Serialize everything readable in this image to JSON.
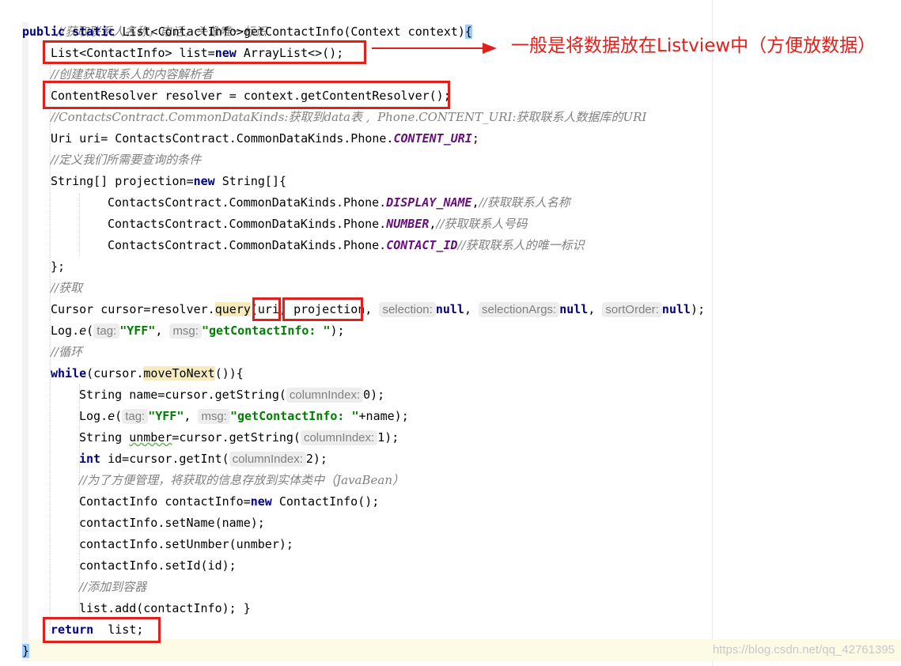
{
  "code": {
    "l1": "//获取联系人名称，电话，头像唯一标识",
    "l2a": "public static ",
    "l2b": "List<ContactInfo>getContactInfo(Context context)",
    "l2c": "{",
    "l3a": "List<ContactInfo> list=",
    "l3b": "new",
    "l3c": " ArrayList<>();",
    "l4": "//创建获取联系人的内容解析者",
    "l5": "ContentResolver resolver = context.getContentResolver();",
    "l6": "//ContactsContract.CommonDataKinds:获取到data表 ,  Phone.CONTENT_URI:获取联系人数据库的URI",
    "l7a": "Uri uri= ContactsContract.CommonDataKinds.Phone.",
    "l7b": "CONTENT_URI",
    "l7c": ";",
    "l8": "//定义我们所需要查询的条件",
    "l9a": "String[] projection=",
    "l9b": "new",
    "l9c": " String[]{",
    "l10a": "ContactsContract.CommonDataKinds.Phone.",
    "l10b": "DISPLAY_NAME",
    "l10c": ",",
    "l10d": "//获取联系人名称",
    "l11a": "ContactsContract.CommonDataKinds.Phone.",
    "l11b": "NUMBER",
    "l11c": ",",
    "l11d": "//获取联系人号码",
    "l12a": "ContactsContract.CommonDataKinds.Phone.",
    "l12b": "CONTACT_ID",
    "l12d": "//获取联系人的唯一标识",
    "l13": "};",
    "l14": "//获取",
    "l15a": "Cursor cursor=resolver.",
    "l15b": "query",
    "l15c": "(",
    "l15d": "uri",
    "l15e": ", ",
    "l15f": "projection",
    "l15g": ", ",
    "h15a": "selection:",
    "l15h": "null",
    "l15i": ", ",
    "h15b": "selectionArgs:",
    "l15j": "null",
    "l15k": ", ",
    "h15c": "sortOrder:",
    "l15l": "null",
    "l15m": ");",
    "l16a": "Log.",
    "l16b": "e",
    "l16c": "(",
    "h16a": "tag:",
    "l16d": "\"YFF\"",
    "l16e": ", ",
    "h16b": "msg:",
    "l16f": "\"getContactInfo: \"",
    "l16g": ");",
    "l17": "//循环",
    "l18a": "while",
    "l18b": "(cursor.",
    "l18c": "moveToNext",
    "l18d": "()){",
    "l19a": "String name=cursor.getString(",
    "h19": "columnIndex:",
    "l19b": "0",
    "l19c": ");",
    "l20a": "Log.",
    "l20b": "e",
    "l20c": "(",
    "h20a": "tag:",
    "l20d": "\"YFF\"",
    "l20e": ", ",
    "h20b": "msg:",
    "l20f": "\"getContactInfo: \"",
    "l20g": "+name);",
    "l21a": "String ",
    "l21b": "unmber",
    "l21c": "=cursor.getString(",
    "h21": "columnIndex:",
    "l21d": "1",
    "l21e": ");",
    "l22a": "int",
    "l22b": " id=cursor.getInt(",
    "h22": "columnIndex:",
    "l22c": "2",
    "l22d": ");",
    "l23": "//为了方便管理，将获取的信息存放到实体类中（JavaBean）",
    "l24a": "ContactInfo contactInfo=",
    "l24b": "new",
    "l24c": " ContactInfo();",
    "l25": "contactInfo.setName(name);",
    "l26": "contactInfo.setUnmber(unmber);",
    "l27": "contactInfo.setId(id);",
    "l28": "//添加到容器",
    "l29": "list.add(contactInfo); }",
    "l30a": "return",
    "l30b": "  list;",
    "l31": "}"
  },
  "annotation": {
    "text": "一般是将数据放在Listview中（方便放数据）",
    "color": "#e0201c"
  },
  "watermark": "https://blog.csdn.net/qq_42761395"
}
